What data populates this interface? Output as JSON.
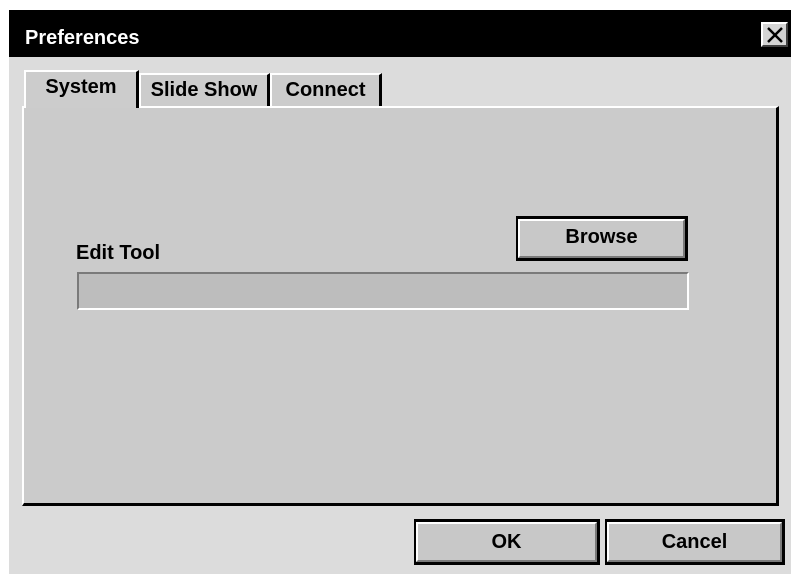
{
  "window": {
    "title": "Preferences",
    "close_icon": "close-icon"
  },
  "tabs": [
    {
      "label": "System",
      "active": true
    },
    {
      "label": "Slide Show",
      "active": false
    },
    {
      "label": "Connect",
      "active": false
    }
  ],
  "system_panel": {
    "edit_tool_label": "Edit Tool",
    "browse_label": "Browse",
    "edit_tool_value": ""
  },
  "footer": {
    "ok_label": "OK",
    "cancel_label": "Cancel"
  },
  "colors": {
    "titlebar": "#000000",
    "title_text": "#ffffff",
    "dialog_bg": "#dcdcdc",
    "panel_bg": "#cbcbcb",
    "button_face": "#c8c8c8"
  }
}
